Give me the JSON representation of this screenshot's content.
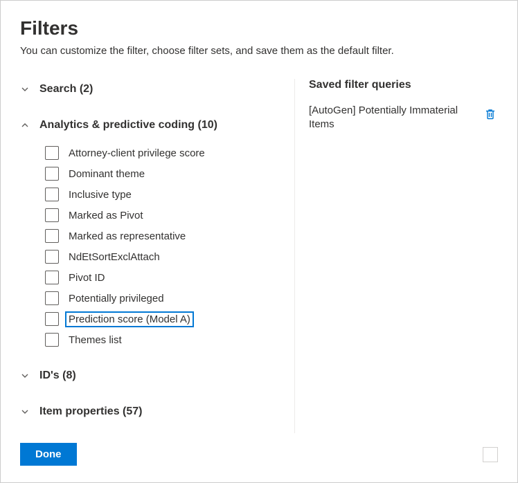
{
  "header": {
    "title": "Filters",
    "subtitle": "You can customize the filter, choose filter sets, and save them as the default filter."
  },
  "sections": {
    "search": {
      "label": "Search (2)"
    },
    "analytics": {
      "label": "Analytics & predictive coding (10)"
    },
    "ids": {
      "label": "ID's (8)"
    },
    "itemprops": {
      "label": "Item properties (57)"
    }
  },
  "analytics_items": [
    {
      "label": "Attorney-client privilege score",
      "highlighted": false
    },
    {
      "label": "Dominant theme",
      "highlighted": false
    },
    {
      "label": "Inclusive type",
      "highlighted": false
    },
    {
      "label": "Marked as Pivot",
      "highlighted": false
    },
    {
      "label": "Marked as representative",
      "highlighted": false
    },
    {
      "label": "NdEtSortExclAttach",
      "highlighted": false
    },
    {
      "label": "Pivot ID",
      "highlighted": false
    },
    {
      "label": "Potentially privileged",
      "highlighted": false
    },
    {
      "label": "Prediction score (Model A)",
      "highlighted": true
    },
    {
      "label": "Themes list",
      "highlighted": false
    }
  ],
  "saved": {
    "title": "Saved filter queries",
    "items": [
      {
        "label": "[AutoGen] Potentially Immaterial Items"
      }
    ]
  },
  "footer": {
    "done": "Done"
  }
}
